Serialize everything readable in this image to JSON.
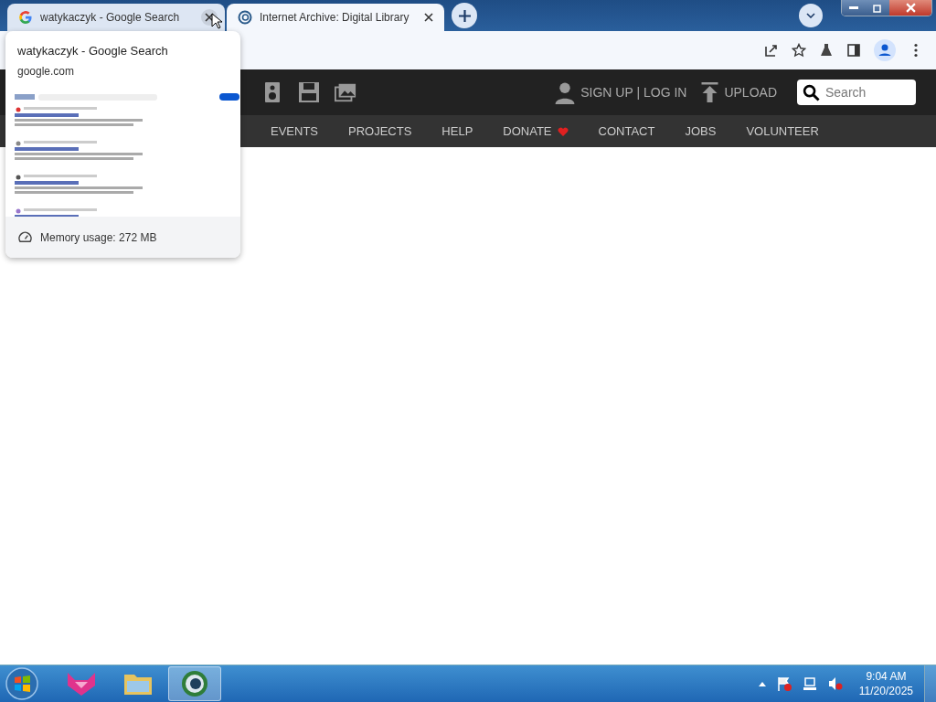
{
  "tabs": [
    {
      "title": "watykaczyk - Google Search",
      "selected": false
    },
    {
      "title": "Internet Archive: Digital Library",
      "selected": true
    }
  ],
  "hover_card": {
    "title": "watykaczyk - Google Search",
    "domain": "google.com",
    "memory": "Memory usage: 272 MB"
  },
  "site": {
    "account": "SIGN UP | LOG IN",
    "upload": "UPLOAD",
    "search": {
      "placeholder": "Search"
    },
    "nav": [
      {
        "label": "EVENTS",
        "heart": false
      },
      {
        "label": "PROJECTS",
        "heart": false
      },
      {
        "label": "HELP",
        "heart": false
      },
      {
        "label": "DONATE",
        "heart": true
      },
      {
        "label": "CONTACT",
        "heart": false
      },
      {
        "label": "JOBS",
        "heart": false
      },
      {
        "label": "VOLUNTEER",
        "heart": false
      }
    ]
  },
  "taskbar": {
    "time": "9:04 AM",
    "date": "11/20/2025"
  }
}
